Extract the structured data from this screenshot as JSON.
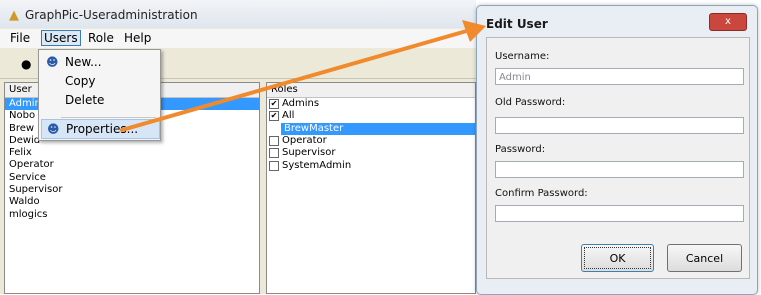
{
  "app": {
    "title": "GraphPic-Useradministration"
  },
  "menubar": {
    "file": "File",
    "users": "Users",
    "role": "Role",
    "help": "Help"
  },
  "users_menu": {
    "items": [
      "New...",
      "Copy",
      "Delete",
      "Properties..."
    ]
  },
  "users_pane": {
    "header": "User",
    "items": [
      "Admin",
      "Nobo",
      "Brew",
      "Dewid",
      "Felix",
      "Operator",
      "Service",
      "Supervisor",
      "Waldo",
      "mlogics"
    ]
  },
  "roles_pane": {
    "header": "Roles",
    "items": [
      {
        "label": "Admins",
        "checked": true
      },
      {
        "label": "All",
        "checked": true
      },
      {
        "label": "BrewMaster",
        "checked": false
      },
      {
        "label": "Operator",
        "checked": false
      },
      {
        "label": "Supervisor",
        "checked": false
      },
      {
        "label": "SystemAdmin",
        "checked": false
      }
    ]
  },
  "dialog": {
    "title": "Edit User",
    "close": "x",
    "username_label": "Username:",
    "username_value": "Admin",
    "old_password_label": "Old Password:",
    "password_label": "Password:",
    "confirm_password_label": "Confirm Password:",
    "ok": "OK",
    "cancel": "Cancel"
  },
  "colors": {
    "arrow": "#f08a2c",
    "selection": "#3399ff"
  }
}
